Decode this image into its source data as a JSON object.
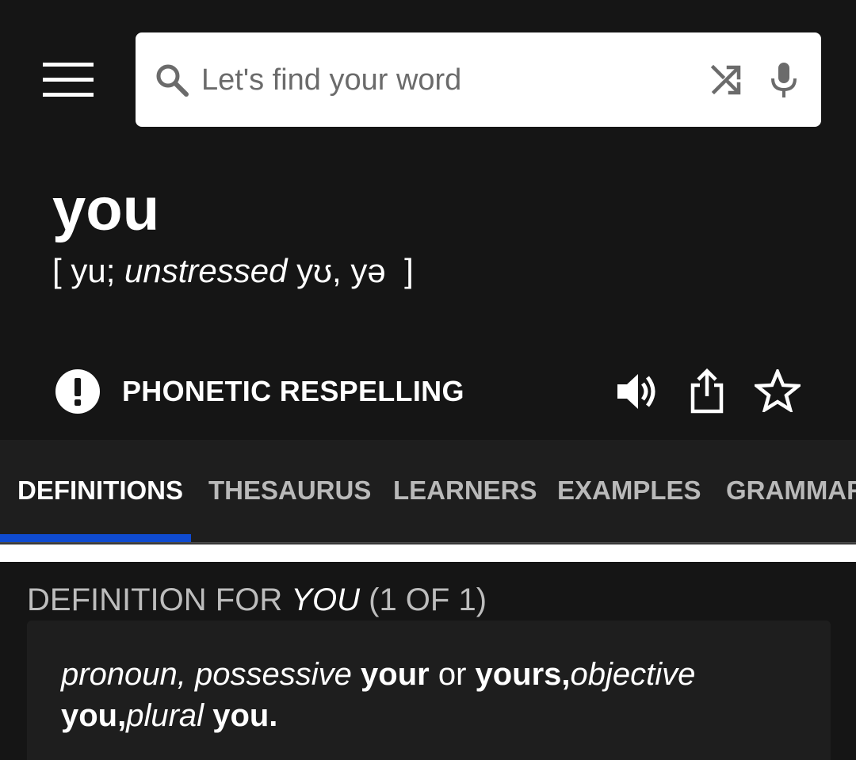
{
  "search": {
    "placeholder": "Let's find your word"
  },
  "entry": {
    "word": "you",
    "pronunciation": {
      "open": "[ ",
      "part1": "yu; ",
      "italic": "unstressed",
      "part2": " yʊ, yə  ",
      "close": "]"
    }
  },
  "actions": {
    "phonetic_respelling_label": "PHONETIC RESPELLING"
  },
  "tabs": [
    {
      "label": "DEFINITIONS",
      "active": true
    },
    {
      "label": "THESAURUS",
      "active": false
    },
    {
      "label": "LEARNERS",
      "active": false
    },
    {
      "label": "EXAMPLES",
      "active": false
    },
    {
      "label": "GRAMMAR",
      "active": false
    }
  ],
  "definition": {
    "heading_prefix": "DEFINITION FOR ",
    "heading_word": "YOU",
    "heading_count": " (1 OF 1)",
    "line": {
      "pos": "pronoun, possessive ",
      "form1": "your",
      "or": " or ",
      "form2": "yours,",
      "objective_label": "objective",
      "form3": "you,",
      "plural_label": "plural",
      "form4": " you."
    }
  },
  "colors": {
    "background": "#151515",
    "tab_bar": "#1e1e1e",
    "tab_indicator": "#0f4bd0",
    "search_bg": "#ffffff"
  },
  "icons": [
    "menu-icon",
    "search-icon",
    "shuffle-icon",
    "microphone-icon",
    "alert-circle-icon",
    "speaker-icon",
    "share-icon",
    "star-outline-icon"
  ]
}
